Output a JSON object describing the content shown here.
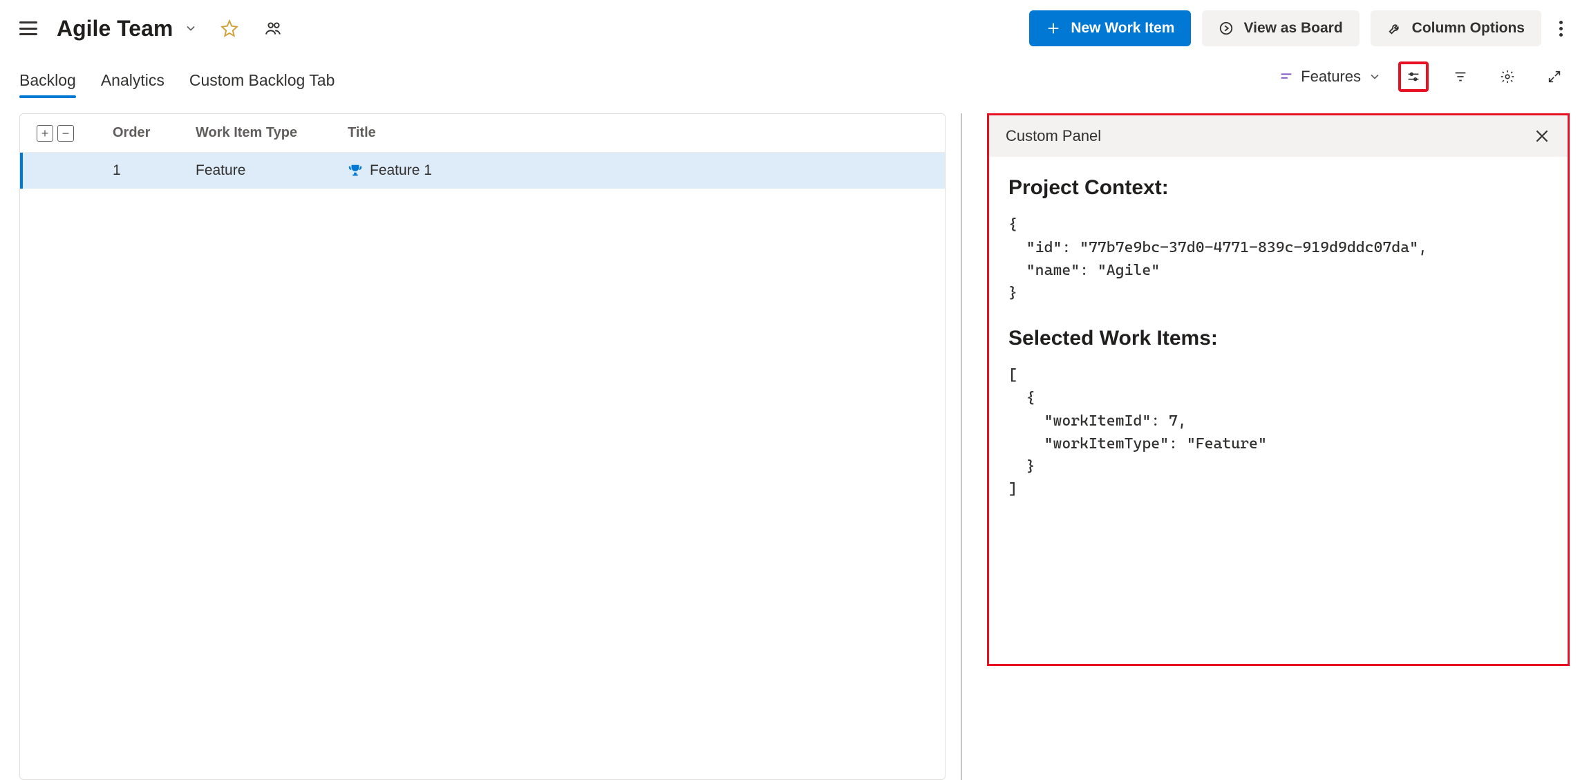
{
  "header": {
    "team_name": "Agile Team",
    "new_work_item_label": "New Work Item",
    "view_as_board_label": "View as Board",
    "column_options_label": "Column Options"
  },
  "tabs": [
    {
      "label": "Backlog",
      "active": true
    },
    {
      "label": "Analytics",
      "active": false
    },
    {
      "label": "Custom Backlog Tab",
      "active": false
    }
  ],
  "level_selector": "Features",
  "backlog": {
    "columns": {
      "order": "Order",
      "type": "Work Item Type",
      "title": "Title"
    },
    "rows": [
      {
        "order": "1",
        "type": "Feature",
        "title": "Feature 1"
      }
    ]
  },
  "panel": {
    "title": "Custom Panel",
    "section1_heading": "Project Context:",
    "section1_json": "{\n  \"id\": \"77b7e9bc-37d0-4771-839c-919d9ddc07da\",\n  \"name\": \"Agile\"\n}",
    "section2_heading": "Selected Work Items:",
    "section2_json": "[\n  {\n    \"workItemId\": 7,\n    \"workItemType\": \"Feature\"\n  }\n]"
  }
}
